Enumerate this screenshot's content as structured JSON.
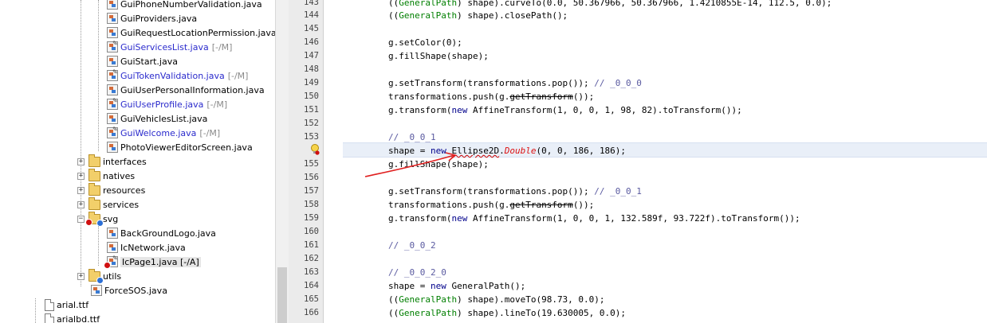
{
  "tree": {
    "items": [
      {
        "label": "GuiPhoneNumberValidation.java",
        "status": "",
        "modified": false
      },
      {
        "label": "GuiProviders.java",
        "status": "",
        "modified": false
      },
      {
        "label": "GuiRequestLocationPermission.java",
        "status": "",
        "modified": false
      },
      {
        "label": "GuiServicesList.java",
        "status": "[-/M]",
        "modified": true
      },
      {
        "label": "GuiStart.java",
        "status": "",
        "modified": false
      },
      {
        "label": "GuiTokenValidation.java",
        "status": "[-/M]",
        "modified": true
      },
      {
        "label": "GuiUserPersonalInformation.java",
        "status": "",
        "modified": false
      },
      {
        "label": "GuiUserProfile.java",
        "status": "[-/M]",
        "modified": true
      },
      {
        "label": "GuiVehiclesList.java",
        "status": "",
        "modified": false
      },
      {
        "label": "GuiWelcome.java",
        "status": "[-/M]",
        "modified": true
      },
      {
        "label": "PhotoViewerEditorScreen.java",
        "status": "",
        "modified": false
      }
    ],
    "folders": [
      {
        "label": "interfaces",
        "expander": "+"
      },
      {
        "label": "natives",
        "expander": "+"
      },
      {
        "label": "resources",
        "expander": "+"
      },
      {
        "label": "services",
        "expander": "+"
      },
      {
        "label": "svg",
        "expander": "−"
      }
    ],
    "svg_items": [
      {
        "label": "BackGroundLogo.java",
        "status": ""
      },
      {
        "label": "IcNetwork.java",
        "status": ""
      },
      {
        "label": "IcPage1.java",
        "status": "[-/A]"
      }
    ],
    "utils_label": "utils",
    "utils_expander": "+",
    "force_sos": "ForceSOS.java",
    "files": [
      "arial.ttf",
      "arialbd.ttf"
    ]
  },
  "editor": {
    "line_numbers": [
      "143",
      "144",
      "145",
      "146",
      "147",
      "148",
      "149",
      "150",
      "151",
      "152",
      "153",
      "154",
      "155",
      "156",
      "157",
      "158",
      "159",
      "160",
      "161",
      "162",
      "163",
      "164",
      "165",
      "166"
    ],
    "lines": {
      "l143_a": "((",
      "l143_cls": "GeneralPath",
      "l143_b": ") shape).curveTo(0.0, 50.367966, 50.367966, 1.4210855E-14, 112.5, 0.0);",
      "l144_a": "((",
      "l144_cls": "GeneralPath",
      "l144_b": ") shape).closePath();",
      "l146": "g.setColor(0);",
      "l147": "g.fillShape(shape);",
      "l149_a": "g.setTransform(transformations.pop()); ",
      "l149_cm": "// _0_0_0",
      "l150_a": "transformations.push(g.",
      "l150_st": "getTransform",
      "l150_b": "());",
      "l151_a": "g.transform(",
      "l151_kw": "new",
      "l151_b": " AffineTransform(1, 0, 0, 1, 98, 82).toTransform());",
      "l153_cm": "// _0_0_1",
      "l154_a": "shape = ",
      "l154_kw": "new",
      "l154_sp": " ",
      "l154_cls": "Ellipse2D",
      "l154_dot": ".",
      "l154_red": "Double",
      "l154_b": "(0, 0, 186, 186);",
      "l155": "g.fillShape(shape);",
      "l157_a": "g.setTransform(transformations.pop()); ",
      "l157_cm": "// _0_0_1",
      "l158_a": "transformations.push(g.",
      "l158_st": "getTransform",
      "l158_b": "());",
      "l159_a": "g.transform(",
      "l159_kw": "new",
      "l159_b": " AffineTransform(1, 0, 0, 1, 132.589f, 93.722f).toTransform());",
      "l161_cm": "// _0_0_2",
      "l163_cm": "// _0_0_2_0",
      "l164_a": "shape = ",
      "l164_kw": "new",
      "l164_b": " GeneralPath();",
      "l165_a": "((",
      "l165_cls": "GeneralPath",
      "l165_b": ") shape).moveTo(98.73, 0.0);",
      "l166_a": "((",
      "l166_cls": "GeneralPath",
      "l166_b": ") shape).lineTo(19.630005, 0.0);"
    }
  },
  "colors": {
    "keyword": "#00008b",
    "class": "#007f00",
    "comment": "#5a5aa0",
    "error": "#dd1111",
    "annotation": "#e02020"
  }
}
